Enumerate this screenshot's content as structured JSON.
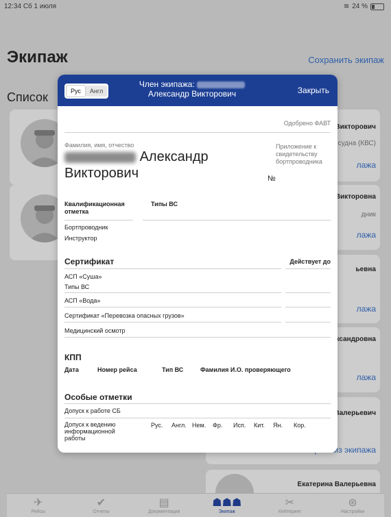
{
  "status": {
    "time": "12:34",
    "date": "Сб 1 июля",
    "battery": "24 %"
  },
  "page": {
    "title": "Экипаж",
    "save_crew": "Сохранить экипаж",
    "list_label": "Список"
  },
  "right_cards": [
    {
      "name": "Викторович",
      "sub": "судна (КВС)",
      "link": "лажа"
    },
    {
      "name": "Викторовна",
      "sub": "дник",
      "link": "лажа"
    },
    {
      "name": "ьевна",
      "link": "лажа"
    },
    {
      "name": "ександровна",
      "link": "лажа"
    },
    {
      "name": "Валерьевич",
      "link": "< Убрать из экипажа"
    },
    {
      "name": "Екатерина Валерьевна"
    }
  ],
  "tabs": [
    {
      "label": "Рейсы",
      "icon": "airplane-icon"
    },
    {
      "label": "Отчеты",
      "icon": "check-icon"
    },
    {
      "label": "Документация",
      "icon": "document-icon"
    },
    {
      "label": "Экипаж",
      "icon": "crew-icon",
      "active": true
    },
    {
      "label": "Кейтеринг",
      "icon": "catering-icon"
    },
    {
      "label": "Настройки",
      "icon": "settings-icon"
    }
  ],
  "modal": {
    "lang_ru": "Рус",
    "lang_en": "Англ",
    "header_line1": "Член экипажа:",
    "header_line2": "Александр Викторович",
    "close": "Закрыть",
    "approved": "Одобрено ФАВТ",
    "fio_label": "Фамилия, имя, отчество",
    "name_part1": "Александр",
    "name_part2": "Викторович",
    "appendix": "Приложение к свидетельству бортпроводника",
    "number_sign": "№",
    "qual_label": "Квалификационная отметка",
    "types_label": "Типы ВС",
    "qual_1": "Бортпроводник",
    "qual_2": "Инструктор",
    "cert_title": "Сертификат",
    "valid_until": "Действует до",
    "asp_land": "АСП «Суша»",
    "types_vs": "Типы ВС",
    "asp_water": "АСП «Вода»",
    "dangerous": "Сертификат «Перевозка опасных грузов»",
    "medical": "Медицинский осмотр",
    "kpp_title": "КПП",
    "kpp_cols": [
      "Дата",
      "Номер рейса",
      "Тип ВС",
      "Фамилия И.О. проверяющего"
    ],
    "special_title": "Особые отметки",
    "sb_access": "Допуск к работе СБ",
    "info_access": "Допуск к ведению информационной работы",
    "langs": [
      "Рус.",
      "Англ.",
      "Нем.",
      "Фр.",
      "Исп.",
      "Кит.",
      "Ян.",
      "Кор."
    ]
  }
}
